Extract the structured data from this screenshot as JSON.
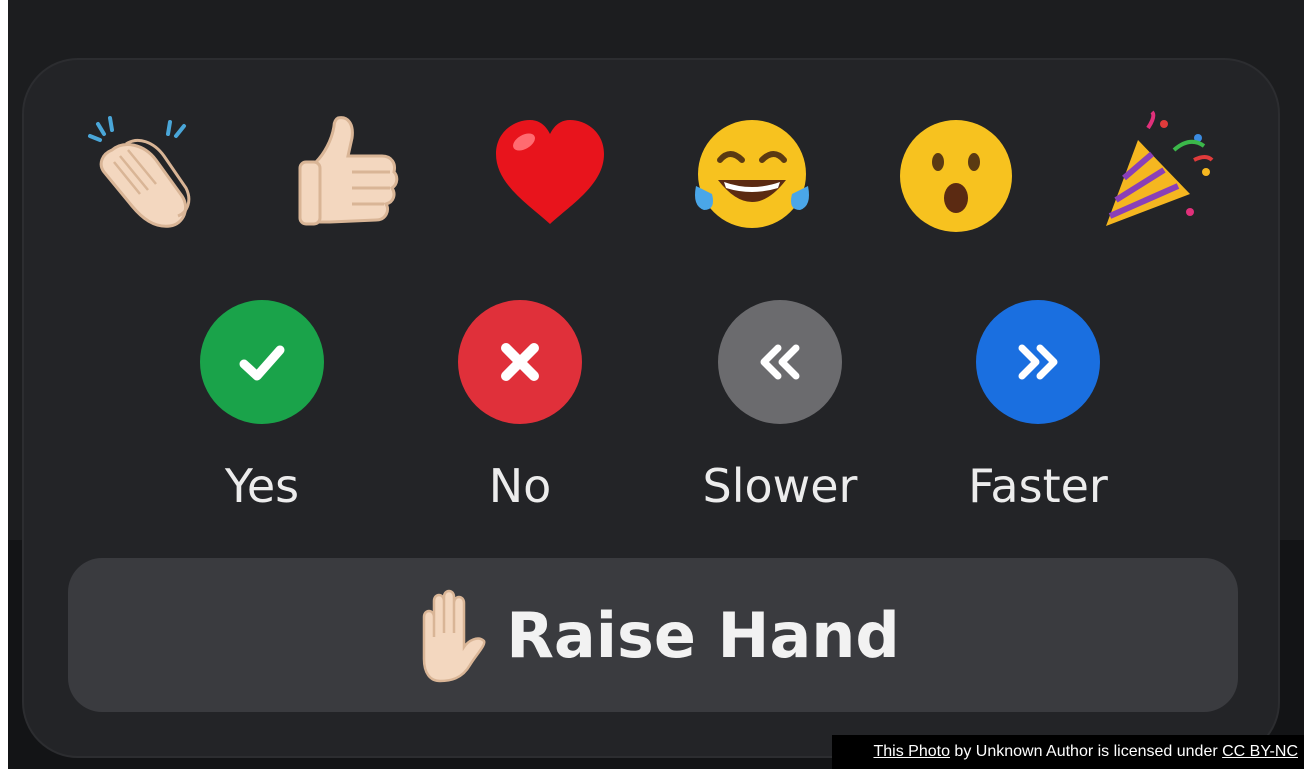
{
  "reactions": [
    {
      "name": "clapping-hands",
      "icon": "clapping-hands-icon"
    },
    {
      "name": "thumbs-up",
      "icon": "thumbs-up-icon"
    },
    {
      "name": "heart",
      "icon": "heart-icon"
    },
    {
      "name": "tears-of-joy",
      "icon": "tears-of-joy-icon"
    },
    {
      "name": "open-mouth",
      "icon": "open-mouth-icon"
    },
    {
      "name": "party-popper",
      "icon": "party-popper-icon"
    }
  ],
  "feedback": [
    {
      "label": "Yes",
      "icon": "check-icon",
      "color": "#1aa34a"
    },
    {
      "label": "No",
      "icon": "close-icon",
      "color": "#e0303a"
    },
    {
      "label": "Slower",
      "icon": "double-chevron-left-icon",
      "color": "#6b6b6e"
    },
    {
      "label": "Faster",
      "icon": "double-chevron-right-icon",
      "color": "#1a6fe0"
    }
  ],
  "raise_hand": {
    "label": "Raise Hand",
    "icon": "raised-hand-icon"
  },
  "credit": {
    "photo_link": "This Photo",
    "middle_text": " by Unknown Author is licensed under ",
    "license_link": "CC BY-NC"
  },
  "colors": {
    "panel_bg": "#232427",
    "button_bg": "#3a3b3f",
    "text": "#ececec"
  }
}
